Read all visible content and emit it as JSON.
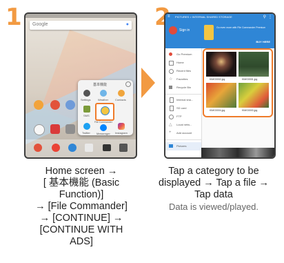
{
  "steps": [
    {
      "number": "1",
      "caption_lines": [
        "Home screen →",
        "[ 基本機能 (Basic",
        "Function)]",
        "→ [File Commander]",
        "→ [CONTINUE] →",
        "[CONTINUE WITH",
        "ADS]"
      ],
      "screen": {
        "search_placeholder": "Google",
        "folder_title": "基本機能",
        "folder_apps": [
          "Settings",
          "Weather",
          "Contacts",
          "SMS",
          "File Commander",
          "Twitter",
          "Messenger",
          "Instagram"
        ]
      }
    },
    {
      "number": "2",
      "caption_lines": [
        "Tap a category to be",
        "displayed → Tap a file →",
        "Tap data"
      ],
      "note": "Data is viewed/played.",
      "screen": {
        "header_path": "PICTURES > INTERNAL SHARED STORAGE",
        "sign_in": "Sign in",
        "promo_text": "Go even more with File Commander Premium",
        "promo_button": "BUY HERE",
        "sidebar_items": [
          "Go Premium",
          "Home",
          "Recent files",
          "Favorites",
          "Recycle Bin",
          "Internal sha...",
          "SD card",
          "FTP",
          "Local netw...",
          "Add account",
          "Pictures"
        ],
        "files": [
          "KIMG0002.jpg",
          "KIMG0001.jpg",
          "KIMG0004.jpg",
          "KIMG0003.jpg"
        ]
      }
    }
  ],
  "colors": {
    "accent": "#f29a42",
    "highlight": "#ef7b2a",
    "blue": "#2f86d6"
  }
}
